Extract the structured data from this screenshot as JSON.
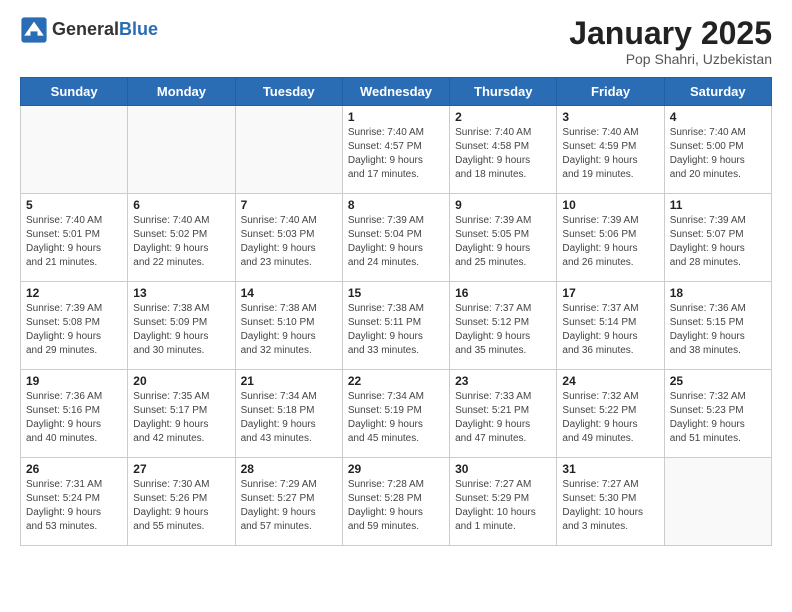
{
  "header": {
    "logo_general": "General",
    "logo_blue": "Blue",
    "title": "January 2025",
    "subtitle": "Pop Shahri, Uzbekistan"
  },
  "days_of_week": [
    "Sunday",
    "Monday",
    "Tuesday",
    "Wednesday",
    "Thursday",
    "Friday",
    "Saturday"
  ],
  "weeks": [
    [
      {
        "day": "",
        "info": ""
      },
      {
        "day": "",
        "info": ""
      },
      {
        "day": "",
        "info": ""
      },
      {
        "day": "1",
        "info": "Sunrise: 7:40 AM\nSunset: 4:57 PM\nDaylight: 9 hours\nand 17 minutes."
      },
      {
        "day": "2",
        "info": "Sunrise: 7:40 AM\nSunset: 4:58 PM\nDaylight: 9 hours\nand 18 minutes."
      },
      {
        "day": "3",
        "info": "Sunrise: 7:40 AM\nSunset: 4:59 PM\nDaylight: 9 hours\nand 19 minutes."
      },
      {
        "day": "4",
        "info": "Sunrise: 7:40 AM\nSunset: 5:00 PM\nDaylight: 9 hours\nand 20 minutes."
      }
    ],
    [
      {
        "day": "5",
        "info": "Sunrise: 7:40 AM\nSunset: 5:01 PM\nDaylight: 9 hours\nand 21 minutes."
      },
      {
        "day": "6",
        "info": "Sunrise: 7:40 AM\nSunset: 5:02 PM\nDaylight: 9 hours\nand 22 minutes."
      },
      {
        "day": "7",
        "info": "Sunrise: 7:40 AM\nSunset: 5:03 PM\nDaylight: 9 hours\nand 23 minutes."
      },
      {
        "day": "8",
        "info": "Sunrise: 7:39 AM\nSunset: 5:04 PM\nDaylight: 9 hours\nand 24 minutes."
      },
      {
        "day": "9",
        "info": "Sunrise: 7:39 AM\nSunset: 5:05 PM\nDaylight: 9 hours\nand 25 minutes."
      },
      {
        "day": "10",
        "info": "Sunrise: 7:39 AM\nSunset: 5:06 PM\nDaylight: 9 hours\nand 26 minutes."
      },
      {
        "day": "11",
        "info": "Sunrise: 7:39 AM\nSunset: 5:07 PM\nDaylight: 9 hours\nand 28 minutes."
      }
    ],
    [
      {
        "day": "12",
        "info": "Sunrise: 7:39 AM\nSunset: 5:08 PM\nDaylight: 9 hours\nand 29 minutes."
      },
      {
        "day": "13",
        "info": "Sunrise: 7:38 AM\nSunset: 5:09 PM\nDaylight: 9 hours\nand 30 minutes."
      },
      {
        "day": "14",
        "info": "Sunrise: 7:38 AM\nSunset: 5:10 PM\nDaylight: 9 hours\nand 32 minutes."
      },
      {
        "day": "15",
        "info": "Sunrise: 7:38 AM\nSunset: 5:11 PM\nDaylight: 9 hours\nand 33 minutes."
      },
      {
        "day": "16",
        "info": "Sunrise: 7:37 AM\nSunset: 5:12 PM\nDaylight: 9 hours\nand 35 minutes."
      },
      {
        "day": "17",
        "info": "Sunrise: 7:37 AM\nSunset: 5:14 PM\nDaylight: 9 hours\nand 36 minutes."
      },
      {
        "day": "18",
        "info": "Sunrise: 7:36 AM\nSunset: 5:15 PM\nDaylight: 9 hours\nand 38 minutes."
      }
    ],
    [
      {
        "day": "19",
        "info": "Sunrise: 7:36 AM\nSunset: 5:16 PM\nDaylight: 9 hours\nand 40 minutes."
      },
      {
        "day": "20",
        "info": "Sunrise: 7:35 AM\nSunset: 5:17 PM\nDaylight: 9 hours\nand 42 minutes."
      },
      {
        "day": "21",
        "info": "Sunrise: 7:34 AM\nSunset: 5:18 PM\nDaylight: 9 hours\nand 43 minutes."
      },
      {
        "day": "22",
        "info": "Sunrise: 7:34 AM\nSunset: 5:19 PM\nDaylight: 9 hours\nand 45 minutes."
      },
      {
        "day": "23",
        "info": "Sunrise: 7:33 AM\nSunset: 5:21 PM\nDaylight: 9 hours\nand 47 minutes."
      },
      {
        "day": "24",
        "info": "Sunrise: 7:32 AM\nSunset: 5:22 PM\nDaylight: 9 hours\nand 49 minutes."
      },
      {
        "day": "25",
        "info": "Sunrise: 7:32 AM\nSunset: 5:23 PM\nDaylight: 9 hours\nand 51 minutes."
      }
    ],
    [
      {
        "day": "26",
        "info": "Sunrise: 7:31 AM\nSunset: 5:24 PM\nDaylight: 9 hours\nand 53 minutes."
      },
      {
        "day": "27",
        "info": "Sunrise: 7:30 AM\nSunset: 5:26 PM\nDaylight: 9 hours\nand 55 minutes."
      },
      {
        "day": "28",
        "info": "Sunrise: 7:29 AM\nSunset: 5:27 PM\nDaylight: 9 hours\nand 57 minutes."
      },
      {
        "day": "29",
        "info": "Sunrise: 7:28 AM\nSunset: 5:28 PM\nDaylight: 9 hours\nand 59 minutes."
      },
      {
        "day": "30",
        "info": "Sunrise: 7:27 AM\nSunset: 5:29 PM\nDaylight: 10 hours\nand 1 minute."
      },
      {
        "day": "31",
        "info": "Sunrise: 7:27 AM\nSunset: 5:30 PM\nDaylight: 10 hours\nand 3 minutes."
      },
      {
        "day": "",
        "info": ""
      }
    ]
  ]
}
